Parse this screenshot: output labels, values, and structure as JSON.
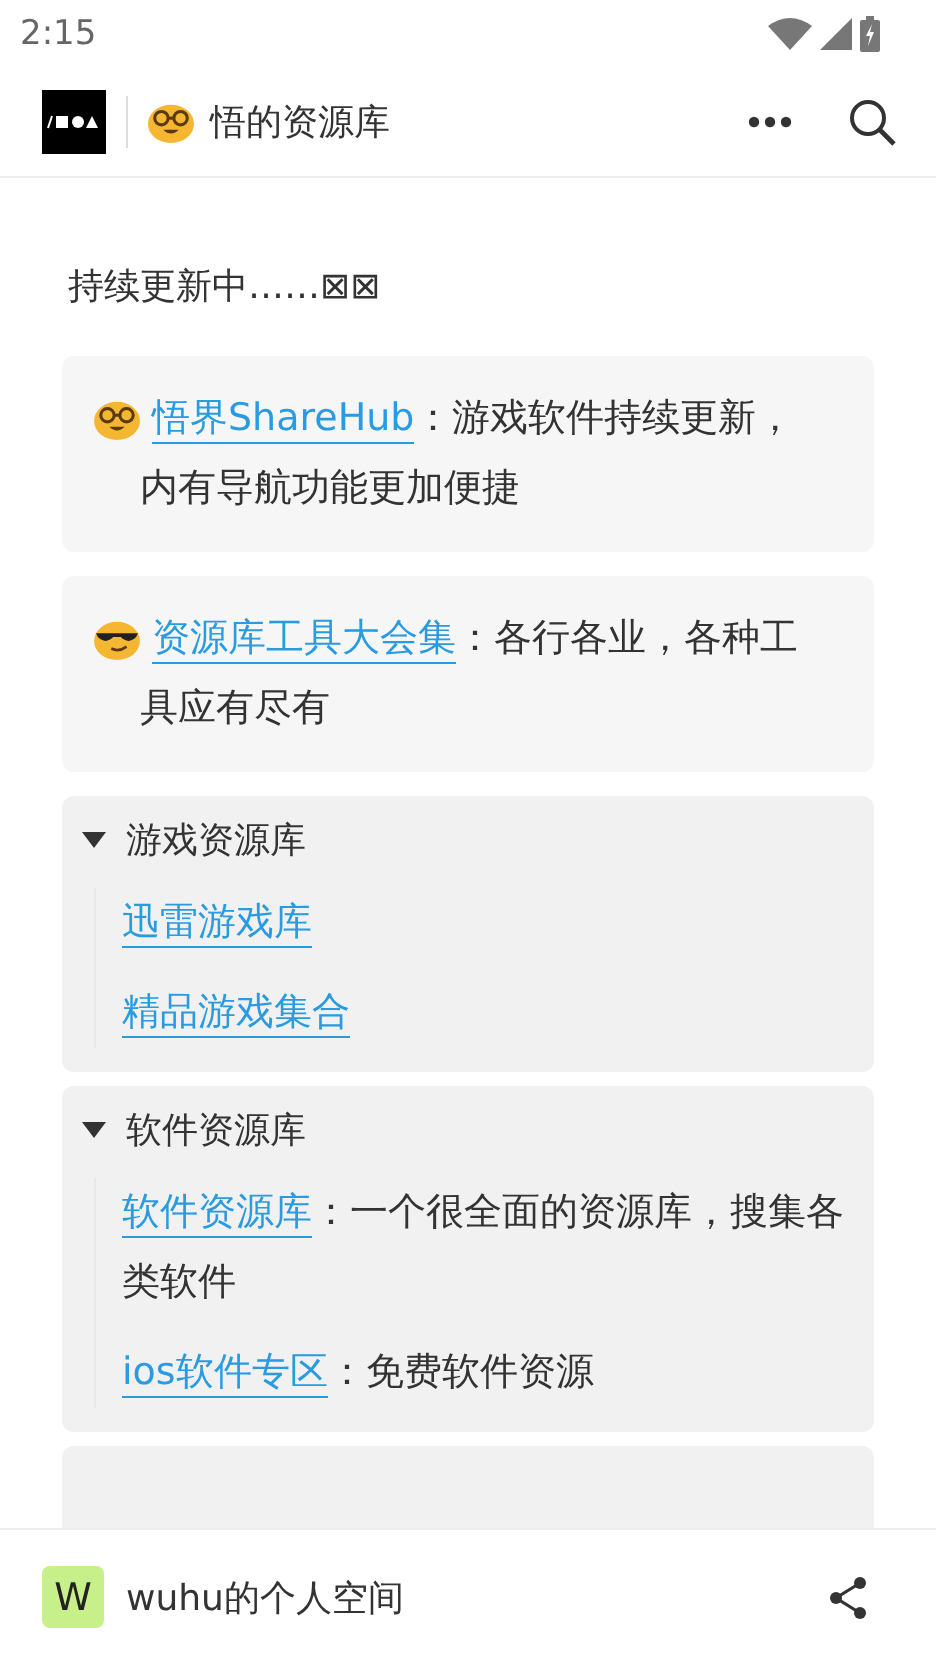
{
  "status_bar": {
    "time": "2:15"
  },
  "header": {
    "title": "悟的资源库"
  },
  "page": {
    "intro": "持续更新中……⊠⊠",
    "cards": [
      {
        "kind": "nerd",
        "link": "悟界ShareHub",
        "text": "：游戏软件持续更新，内有导航功能更加便捷"
      },
      {
        "kind": "cool",
        "link": "资源库工具大会集",
        "text": "：各行各业，各种工具应有尽有"
      }
    ],
    "sections": [
      {
        "title": "游戏资源库",
        "expanded": true,
        "items": [
          {
            "link": "迅雷游戏库"
          },
          {
            "link": "精品游戏集合"
          }
        ]
      },
      {
        "title": "软件资源库",
        "expanded": true,
        "items": [
          {
            "link": "软件资源库",
            "text": "：一个很全面的资源库，搜集各类软件"
          },
          {
            "link": "ios软件专区",
            "text": "：免费软件资源"
          }
        ]
      }
    ]
  },
  "bottom_bar": {
    "avatar": "W",
    "name": "wuhu的个人空间"
  }
}
